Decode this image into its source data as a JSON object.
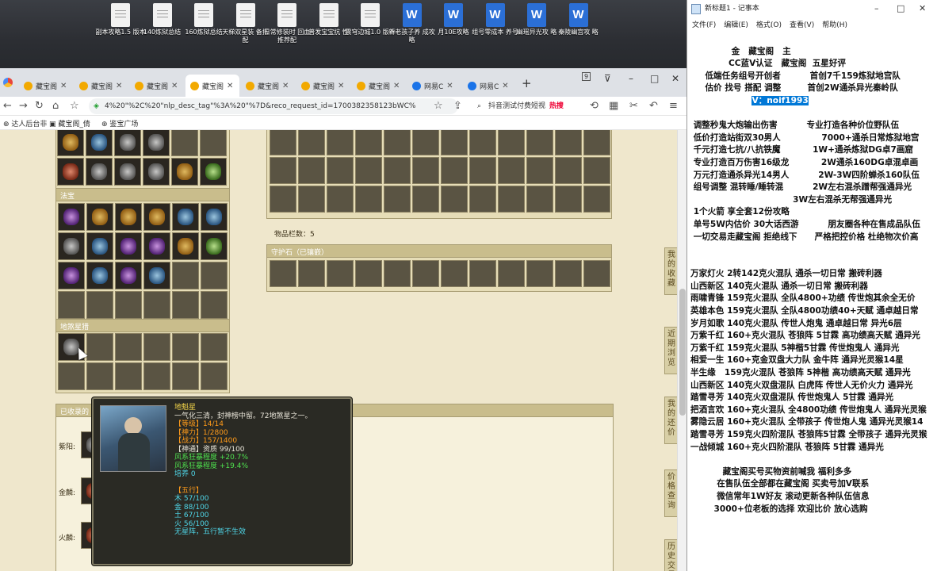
{
  "desktop": {
    "icons": [
      {
        "label": "副本攻略1.5 版本",
        "type": "txt"
      },
      {
        "label": "140炼狱总结",
        "type": "txt"
      },
      {
        "label": "160炼狱总结",
        "type": "txt"
      },
      {
        "label": "天梯双星装 备搭配",
        "type": "txt"
      },
      {
        "label": "日常修装时 回血推荐配",
        "type": "txt"
      },
      {
        "label": "普发宝宝抗 性",
        "type": "txt"
      },
      {
        "label": "震穹边城1.0 版本",
        "type": "txt"
      },
      {
        "label": "新老孩子养 成攻略",
        "type": "doc"
      },
      {
        "label": "月10E攻略",
        "type": "doc"
      },
      {
        "label": "组号零成本 养号",
        "type": "doc"
      },
      {
        "label": "幽瑶异光攻 略",
        "type": "doc"
      },
      {
        "label": "秦陵幽宫攻 略",
        "type": "doc"
      }
    ]
  },
  "browser": {
    "tabs": [
      {
        "label": "藏宝阁",
        "icon_color": "#f2a900"
      },
      {
        "label": "藏宝阁",
        "icon_color": "#f2a900"
      },
      {
        "label": "藏宝阁",
        "icon_color": "#f2a900"
      },
      {
        "label": "藏宝阁",
        "icon_color": "#f2a900",
        "active": true
      },
      {
        "label": "藏宝阁",
        "icon_color": "#f2a900"
      },
      {
        "label": "藏宝阁",
        "icon_color": "#f2a900"
      },
      {
        "label": "藏宝阁",
        "icon_color": "#f2a900"
      },
      {
        "label": "网易C",
        "icon_color": "#1a73e8"
      },
      {
        "label": "网易C",
        "icon_color": "#1a73e8"
      }
    ],
    "new_tab": "+",
    "tab_count_badge": "9",
    "url": "4%20\"%2C%20\"nlp_desc_tag\"%3A%20\"%7D&reco_request_id=1700382358123bWC%",
    "search_text": "抖音测试付费短视",
    "search_hot": "热搜",
    "bookmarks": [
      {
        "label": "达人后台非"
      },
      {
        "label": "藏宝阁_倩"
      },
      {
        "label": "鉴宝广场"
      }
    ]
  },
  "game": {
    "section_fabao": "法宝",
    "section_dishaxing": "地煞星猎",
    "section_collected": "已收录的",
    "goods_count_label": "物品栏数：5",
    "guard_stone_label": "守护石（已镶嵌）",
    "row_labels": [
      "紫阳:",
      "金麟:",
      "火麟:"
    ],
    "side_tabs": [
      "我的收藏",
      "近期浏览",
      "我的还价",
      "价格查询",
      "历史交易"
    ],
    "tooltip": {
      "name": "地魁星",
      "desc": "一气化三清，封神榜中留。72地煞星之一。",
      "level": "【等级】14/14",
      "shenli": "【神力】1/2800",
      "zhanli": "【战力】157/1400",
      "shentong": "【神通】资质     99/100",
      "bonus1": "风系狂暴程度 +20.7%",
      "bonus2": "风系狂暴程度 +19.4%",
      "peiyang": "培养 0",
      "wuxing_title": "【五行】",
      "wuxing": [
        "木 57/100",
        "金 88/100",
        "土 67/100",
        "火 56/100"
      ],
      "note": "无星阵，五行暂不生效"
    }
  },
  "notepad": {
    "title": "新标题1 - 记事本",
    "menu": [
      "文件(F)",
      "编辑(E)",
      "格式(O)",
      "查看(V)",
      "帮助(H)"
    ],
    "lines": [
      "",
      "              金   藏宝阁   主",
      "             CC蓝V认证   藏宝阁  五星好评",
      "     低端任务组号开创者          首创7千159炼狱地宫队",
      "     估价 找号 搭配 调整         首创2W通杀异光秦岭队",
      "                     V：noif1993",
      "",
      " 调整秒鬼大炮输出伤害          专业打造各种价位野队伍",
      " 低价打造站街双30男人              7000+通杀日常炼狱地宫",
      " 千元打造七抗/八抗铁魔           1W+通杀炼狱DG卓7画窟",
      " 专业打造百万伤害16级龙           2W通杀160DG卓混卓画",
      " 万元打造通杀异光14男人          2W-3W四阶蝉杀160队伍",
      " 组号调整 混转睡/睡转混          2W左右混杀蹭帮强通异光",
      "                                   3W左右混杀无帮强通异光",
      " 1个火箭 享全套12份攻略",
      " 单号5W内估价 30大话西游          朋友圈各种在售成品队伍",
      " 一切交易走藏宝阁 拒绝线下      严格把控价格 杜绝物次价高",
      "",
      "",
      "万家灯火 2转142克火混队 通杀一切日常 搬砖利器",
      "山西新区 140克火混队 通杀一切日常 搬砖利器",
      "雨啸青锋 159克火混队 全队4800+功绩 传世炮其余全无价",
      "英雄本色 159克火混队 全队4800功绩40+天赋 通卓越日常",
      "岁月如歌 140克火混队 传世人炮鬼 通卓越日常 异光6层",
      "万紫千红 160+克火混队 苍狼阵 5甘霖 高功绩高天赋 通异光",
      "万紫千红 159克火混队 5神楷5甘霖 传世炮鬼人 通异光",
      "相爱一生 160+克金双盘大力队 金牛阵 通异光灵猴14星",
      "半生缘   159克火混队 苍狼阵 5神楷 高功绩高天赋 通异光",
      "山西新区 140克火双盘混队 白虎阵 传世人无价火力 通异光",
      "踏雪寻芳 140克火双盘混队 传世炮鬼人 5甘霖 通异光",
      "把酒言欢 160+克火混队 全4800功绩 传世炮鬼人 通异光灵猴",
      "雾隐云居 160+克火混队 全带孩子 传世炮人鬼 通异光灵猴14",
      "踏雪寻芳 159克火四阶混队 苍狼阵5甘霖 全带孩子 通异光灵猴",
      "一战倾城 160+克火四阶混队 苍狼阵 5甘霖 通异光",
      "",
      "           藏宝阁买号买物资前喊我 福利多多",
      "         在售队伍全部都在藏宝阁 买卖号加V联系",
      "         微信常年1W好友 滚动更新各种队伍信息",
      "        3000+位老板的选择 欢迎比价 放心选购"
    ],
    "selected_line_index": 5,
    "selected_text": "V：noif1993"
  }
}
